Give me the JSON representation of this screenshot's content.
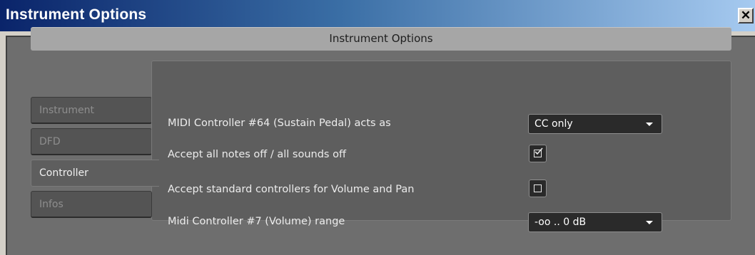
{
  "window": {
    "title": "Instrument Options",
    "close_glyph": "✕"
  },
  "header": {
    "title": "Instrument Options"
  },
  "tabs": [
    {
      "label": "Instrument",
      "active": false
    },
    {
      "label": "DFD",
      "active": false
    },
    {
      "label": "Controller",
      "active": true
    },
    {
      "label": "Infos",
      "active": false
    }
  ],
  "options": {
    "sustain": {
      "label": "MIDI Controller #64 (Sustain Pedal) acts as",
      "value": "CC only"
    },
    "notes_off": {
      "label": "Accept all notes off / all sounds off",
      "checked": true
    },
    "std_controllers": {
      "label": "Accept standard controllers for Volume and Pan",
      "checked": false
    },
    "volume_range": {
      "label": "Midi Controller #7 (Volume) range",
      "value": "-oo .. 0 dB"
    }
  },
  "colors": {
    "title_gradient_start": "#0a246a",
    "title_gradient_end": "#a6caf0",
    "panel": "#5e5e5e",
    "client": "#6e6e6e"
  },
  "icons": {
    "close": "close-icon",
    "check": "checkmark-icon",
    "dropdown": "chevron-down-icon"
  }
}
